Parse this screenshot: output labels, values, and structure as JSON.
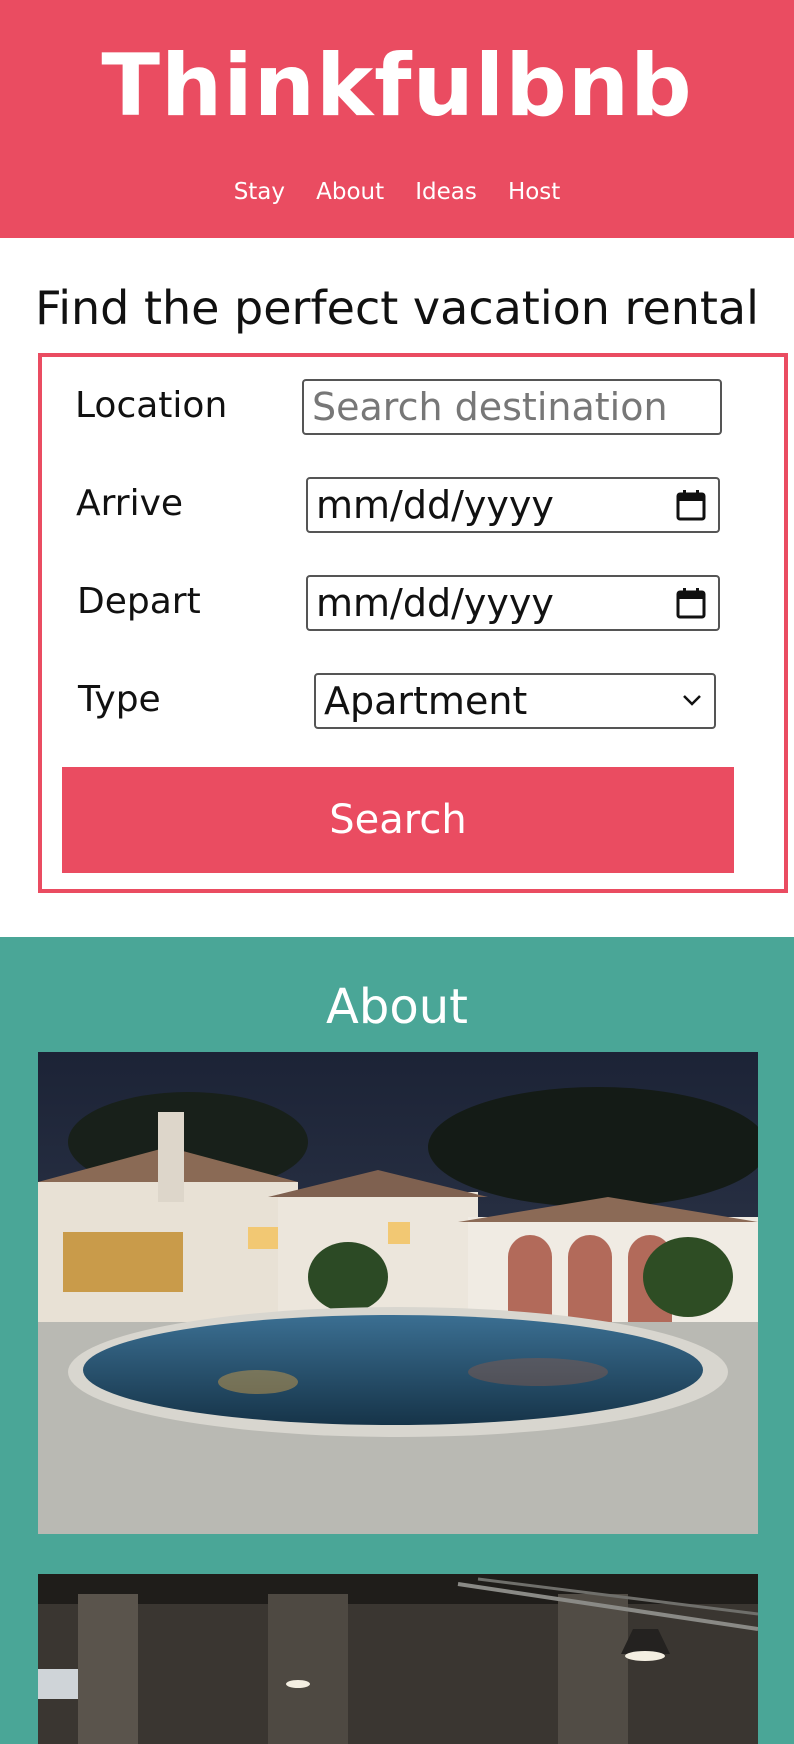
{
  "header": {
    "brand": "Thinkfulbnb",
    "nav": [
      "Stay",
      "About",
      "Ideas",
      "Host"
    ]
  },
  "search": {
    "title": "Find the perfect vacation rental",
    "location_label": "Location",
    "location_placeholder": "Search destination",
    "arrive_label": "Arrive",
    "arrive_value": "mm/dd/yyyy",
    "depart_label": "Depart",
    "depart_value": "mm/dd/yyyy",
    "type_label": "Type",
    "type_value": "Apartment",
    "button_label": "Search"
  },
  "about": {
    "title": "About"
  },
  "colors": {
    "brand": "#ea4c61",
    "about_bg": "#4aa697"
  }
}
